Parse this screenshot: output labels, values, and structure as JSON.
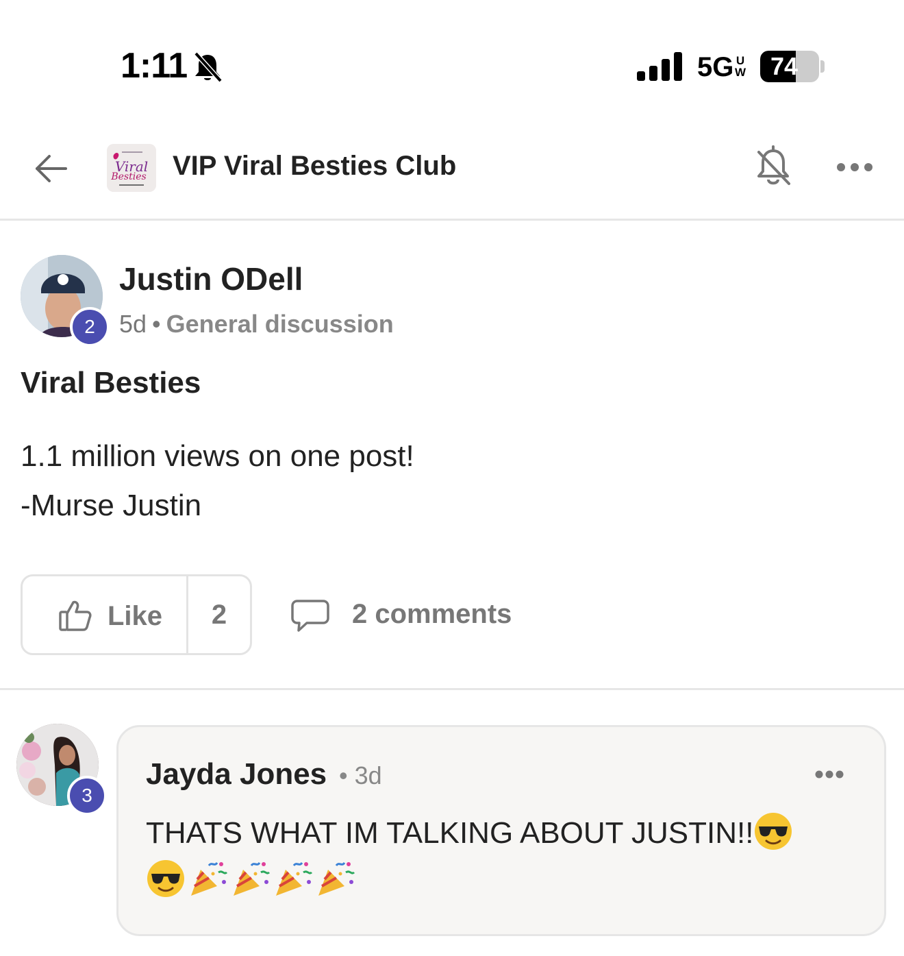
{
  "status_bar": {
    "time": "1:11",
    "network": "5G",
    "network_sub": "UW",
    "battery_percent": 74
  },
  "header": {
    "group_title": "VIP Viral Besties Club",
    "logo_alt": "Viral Besties"
  },
  "post": {
    "author": "Justin ODell",
    "author_badge": "2",
    "age": "5d",
    "category": "General discussion",
    "title": "Viral Besties",
    "body_lines": [
      "1.1 million views on one post!",
      "-Murse Justin"
    ],
    "like_label": "Like",
    "like_count": "2",
    "comments_label": "2 comments"
  },
  "comment": {
    "author": "Jayda Jones",
    "author_badge": "3",
    "age": "3d",
    "text": "THATS WHAT IM TALKING ABOUT JUSTIN!!",
    "emojis": [
      "sunglasses-face",
      "sunglasses-face",
      "party-popper",
      "party-popper",
      "party-popper",
      "party-popper"
    ]
  },
  "colors": {
    "badge": "#4a4db0",
    "muted_text": "#777777",
    "divider": "#e6e6e6",
    "bubble_bg": "#f7f6f4"
  }
}
